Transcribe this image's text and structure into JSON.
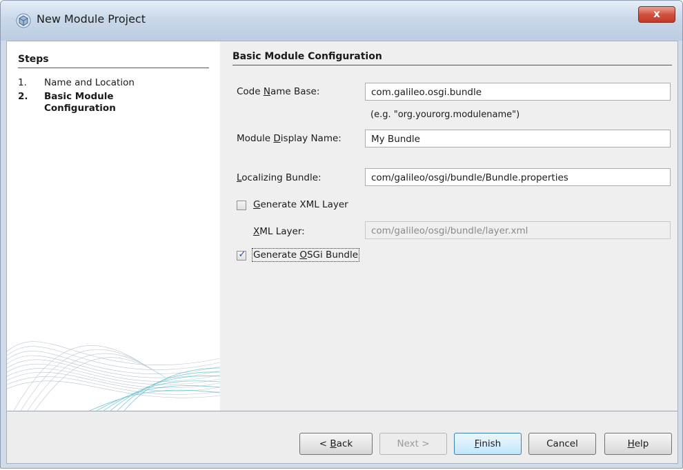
{
  "window": {
    "title": "New Module Project",
    "close_label": "x",
    "title_icon": "cube-icon"
  },
  "steps": {
    "header": "Steps",
    "items": [
      {
        "num": "1.",
        "label": "Name and Location",
        "current": false
      },
      {
        "num": "2.",
        "label": "Basic Module Configuration",
        "current": true
      }
    ]
  },
  "config": {
    "header": "Basic Module Configuration",
    "code_name_base": {
      "label_pre": "Code ",
      "label_mn": "N",
      "label_post": "ame Base:",
      "value": "com.galileo.osgi.bundle",
      "hint": "(e.g. \"org.yourorg.modulename\")"
    },
    "display_name": {
      "label_pre": "Module ",
      "label_mn": "D",
      "label_post": "isplay Name:",
      "value": "My Bundle"
    },
    "localizing_bundle": {
      "label_pre": "",
      "label_mn": "L",
      "label_post": "ocalizing Bundle:",
      "value": "com/galileo/osgi/bundle/Bundle.properties"
    },
    "generate_xml_layer": {
      "label_pre": "",
      "label_mn": "G",
      "label_post": "enerate XML Layer",
      "checked": false
    },
    "xml_layer": {
      "label_pre": "",
      "label_mn": "X",
      "label_post": "ML Layer:",
      "value": "com/galileo/osgi/bundle/layer.xml",
      "enabled": false
    },
    "generate_osgi_bundle": {
      "label_pre": "Generate ",
      "label_mn": "O",
      "label_post": "SGi Bundle",
      "checked": true
    }
  },
  "buttons": {
    "back": {
      "pre": "< ",
      "mn": "B",
      "post": "ack"
    },
    "next": {
      "label": "Next >",
      "enabled": false
    },
    "finish": {
      "pre": "",
      "mn": "F",
      "post": "inish"
    },
    "cancel": {
      "label": "Cancel"
    },
    "help": {
      "pre": "",
      "mn": "H",
      "post": "elp"
    }
  },
  "colors": {
    "titlebar": "#c9d8e9",
    "close_button": "#c0392b",
    "checkbox_mark": "#2b4a93"
  }
}
